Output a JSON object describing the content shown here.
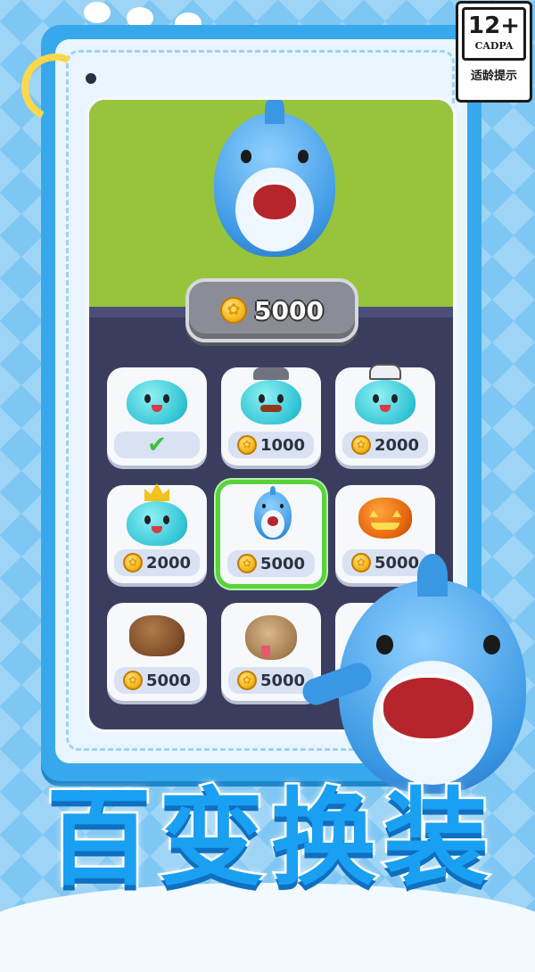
{
  "badge": {
    "age": "12+",
    "org": "CADPA",
    "label": "适龄提示"
  },
  "price_button": {
    "amount": "5000",
    "icon": "coin-icon"
  },
  "items": [
    {
      "character": "slime-blob",
      "accessory": "none",
      "price": "",
      "owned": true,
      "selected": false
    },
    {
      "character": "slime-blob",
      "accessory": "hat-mustache",
      "price": "1000",
      "owned": false,
      "selected": false
    },
    {
      "character": "slime-blob",
      "accessory": "chef-hat",
      "price": "2000",
      "owned": false,
      "selected": false
    },
    {
      "character": "slime-blob",
      "accessory": "crown-sword",
      "price": "2000",
      "owned": false,
      "selected": false
    },
    {
      "character": "shark",
      "accessory": "none",
      "price": "5000",
      "owned": false,
      "selected": true
    },
    {
      "character": "pumpkin",
      "accessory": "none",
      "price": "5000",
      "owned": false,
      "selected": false
    },
    {
      "character": "capybara",
      "accessory": "none",
      "price": "5000",
      "owned": false,
      "selected": false
    },
    {
      "character": "pug",
      "accessory": "none",
      "price": "5000",
      "owned": false,
      "selected": false
    },
    {
      "character": "hidden",
      "accessory": "none",
      "price": "",
      "owned": false,
      "selected": false
    }
  ],
  "title": [
    "百",
    "变",
    "换",
    "装"
  ],
  "colors": {
    "accent": "#1aa0f2",
    "selected": "#58d33b",
    "grass": "#97c43b"
  }
}
